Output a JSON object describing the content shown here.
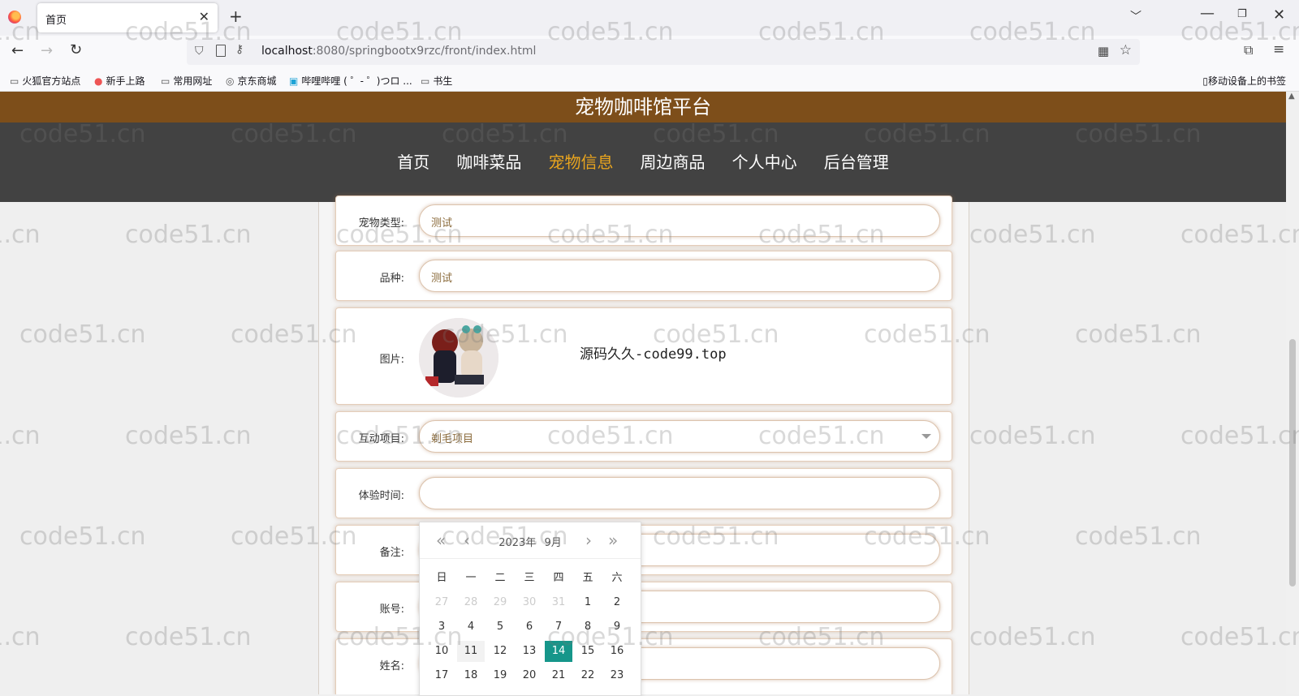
{
  "browser": {
    "tab_title": "首页",
    "url_host": "localhost",
    "url_path": ":8080/springbootx9rzc/front/index.html",
    "bookmarks": [
      "火狐官方站点",
      "新手上路",
      "常用网址",
      "京东商城",
      "哔哩哔哩 ( ゜- ゜)つロ ...",
      "书生"
    ],
    "mobile_bookmarks": "移动设备上的书签"
  },
  "site": {
    "title": "宠物咖啡馆平台",
    "nav": [
      "首页",
      "咖啡菜品",
      "宠物信息",
      "周边商品",
      "个人中心",
      "后台管理"
    ],
    "active_nav_index": 2,
    "accent_color": "#e8a41e",
    "header_color": "#7d4e1a"
  },
  "form": {
    "pet_type_label": "宠物类型:",
    "pet_type_value": "测试",
    "breed_label": "品种:",
    "breed_value": "测试",
    "image_label": "图片:",
    "image_watermark": "源码久久-code99.top",
    "activity_label": "互动项目:",
    "activity_value": "剃毛项目",
    "time_label": "体验时间:",
    "time_value": "",
    "note_label": "备注:",
    "account_label": "账号:",
    "name_label": "姓名:"
  },
  "calendar": {
    "year": "2023年",
    "month": "9月",
    "weekdays": [
      "日",
      "一",
      "二",
      "三",
      "四",
      "五",
      "六"
    ],
    "rows": [
      [
        "27",
        "28",
        "29",
        "30",
        "31",
        "1",
        "2"
      ],
      [
        "3",
        "4",
        "5",
        "6",
        "7",
        "8",
        "9"
      ],
      [
        "10",
        "11",
        "12",
        "13",
        "14",
        "15",
        "16"
      ],
      [
        "17",
        "18",
        "19",
        "20",
        "21",
        "22",
        "23"
      ]
    ],
    "selected_day": "14",
    "selected_color": "#16968a"
  },
  "watermark": "code51.cn"
}
